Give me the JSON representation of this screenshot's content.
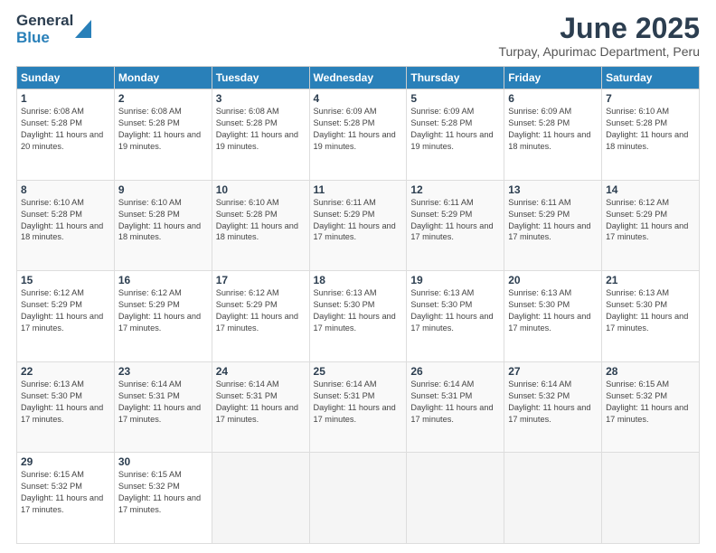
{
  "header": {
    "logo_general": "General",
    "logo_blue": "Blue",
    "month_title": "June 2025",
    "subtitle": "Turpay, Apurimac Department, Peru"
  },
  "weekdays": [
    "Sunday",
    "Monday",
    "Tuesday",
    "Wednesday",
    "Thursday",
    "Friday",
    "Saturday"
  ],
  "weeks": [
    [
      {
        "day": "1",
        "sunrise": "6:08 AM",
        "sunset": "5:28 PM",
        "daylight": "11 hours and 20 minutes."
      },
      {
        "day": "2",
        "sunrise": "6:08 AM",
        "sunset": "5:28 PM",
        "daylight": "11 hours and 19 minutes."
      },
      {
        "day": "3",
        "sunrise": "6:08 AM",
        "sunset": "5:28 PM",
        "daylight": "11 hours and 19 minutes."
      },
      {
        "day": "4",
        "sunrise": "6:09 AM",
        "sunset": "5:28 PM",
        "daylight": "11 hours and 19 minutes."
      },
      {
        "day": "5",
        "sunrise": "6:09 AM",
        "sunset": "5:28 PM",
        "daylight": "11 hours and 19 minutes."
      },
      {
        "day": "6",
        "sunrise": "6:09 AM",
        "sunset": "5:28 PM",
        "daylight": "11 hours and 18 minutes."
      },
      {
        "day": "7",
        "sunrise": "6:10 AM",
        "sunset": "5:28 PM",
        "daylight": "11 hours and 18 minutes."
      }
    ],
    [
      {
        "day": "8",
        "sunrise": "6:10 AM",
        "sunset": "5:28 PM",
        "daylight": "11 hours and 18 minutes."
      },
      {
        "day": "9",
        "sunrise": "6:10 AM",
        "sunset": "5:28 PM",
        "daylight": "11 hours and 18 minutes."
      },
      {
        "day": "10",
        "sunrise": "6:10 AM",
        "sunset": "5:28 PM",
        "daylight": "11 hours and 18 minutes."
      },
      {
        "day": "11",
        "sunrise": "6:11 AM",
        "sunset": "5:29 PM",
        "daylight": "11 hours and 17 minutes."
      },
      {
        "day": "12",
        "sunrise": "6:11 AM",
        "sunset": "5:29 PM",
        "daylight": "11 hours and 17 minutes."
      },
      {
        "day": "13",
        "sunrise": "6:11 AM",
        "sunset": "5:29 PM",
        "daylight": "11 hours and 17 minutes."
      },
      {
        "day": "14",
        "sunrise": "6:12 AM",
        "sunset": "5:29 PM",
        "daylight": "11 hours and 17 minutes."
      }
    ],
    [
      {
        "day": "15",
        "sunrise": "6:12 AM",
        "sunset": "5:29 PM",
        "daylight": "11 hours and 17 minutes."
      },
      {
        "day": "16",
        "sunrise": "6:12 AM",
        "sunset": "5:29 PM",
        "daylight": "11 hours and 17 minutes."
      },
      {
        "day": "17",
        "sunrise": "6:12 AM",
        "sunset": "5:29 PM",
        "daylight": "11 hours and 17 minutes."
      },
      {
        "day": "18",
        "sunrise": "6:13 AM",
        "sunset": "5:30 PM",
        "daylight": "11 hours and 17 minutes."
      },
      {
        "day": "19",
        "sunrise": "6:13 AM",
        "sunset": "5:30 PM",
        "daylight": "11 hours and 17 minutes."
      },
      {
        "day": "20",
        "sunrise": "6:13 AM",
        "sunset": "5:30 PM",
        "daylight": "11 hours and 17 minutes."
      },
      {
        "day": "21",
        "sunrise": "6:13 AM",
        "sunset": "5:30 PM",
        "daylight": "11 hours and 17 minutes."
      }
    ],
    [
      {
        "day": "22",
        "sunrise": "6:13 AM",
        "sunset": "5:30 PM",
        "daylight": "11 hours and 17 minutes."
      },
      {
        "day": "23",
        "sunrise": "6:14 AM",
        "sunset": "5:31 PM",
        "daylight": "11 hours and 17 minutes."
      },
      {
        "day": "24",
        "sunrise": "6:14 AM",
        "sunset": "5:31 PM",
        "daylight": "11 hours and 17 minutes."
      },
      {
        "day": "25",
        "sunrise": "6:14 AM",
        "sunset": "5:31 PM",
        "daylight": "11 hours and 17 minutes."
      },
      {
        "day": "26",
        "sunrise": "6:14 AM",
        "sunset": "5:31 PM",
        "daylight": "11 hours and 17 minutes."
      },
      {
        "day": "27",
        "sunrise": "6:14 AM",
        "sunset": "5:32 PM",
        "daylight": "11 hours and 17 minutes."
      },
      {
        "day": "28",
        "sunrise": "6:15 AM",
        "sunset": "5:32 PM",
        "daylight": "11 hours and 17 minutes."
      }
    ],
    [
      {
        "day": "29",
        "sunrise": "6:15 AM",
        "sunset": "5:32 PM",
        "daylight": "11 hours and 17 minutes."
      },
      {
        "day": "30",
        "sunrise": "6:15 AM",
        "sunset": "5:32 PM",
        "daylight": "11 hours and 17 minutes."
      },
      null,
      null,
      null,
      null,
      null
    ]
  ]
}
